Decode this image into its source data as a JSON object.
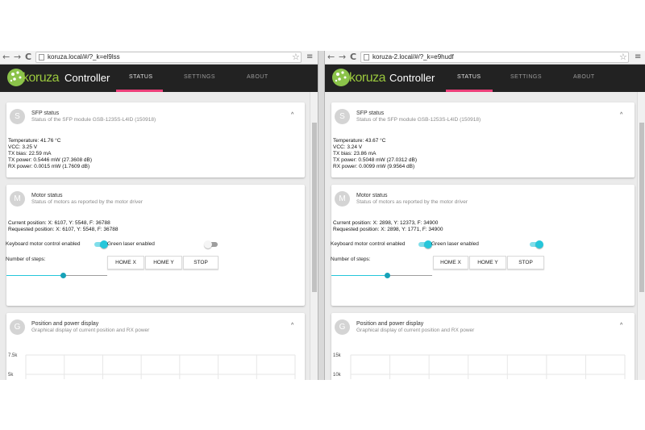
{
  "colors": {
    "accent": "#26c6da",
    "tab_underline": "#ec407a",
    "navbar": "#222222",
    "brand_green": "#9ac83d"
  },
  "windows": [
    {
      "nav": {
        "back": "←",
        "forward": "→",
        "reload": "C"
      },
      "url": "koruza.local/#/?_k=el9lss",
      "star_icon": "☆",
      "menu_icon": "≡",
      "brand": "koruza",
      "title": "Controller",
      "tabs": [
        "STATUS",
        "SETTINGS",
        "ABOUT"
      ],
      "sfp": {
        "avatar": "S",
        "title": "SFP status",
        "subtitle": "Status of the SFP module GSB-1235S-L4ID (150918)",
        "chevron": "^",
        "lines": [
          "Temperature: 41.76 °C",
          "VCC: 3.25 V",
          "TX bias: 22.59 mA",
          "TX power: 0.5446 mW (27.3608 dB)",
          "RX power: 0.0015 mW (1.7609 dB)"
        ]
      },
      "motor": {
        "avatar": "M",
        "title": "Motor status",
        "subtitle": "Status of motors as reported by the motor driver",
        "current": "Current position: X: 6107, Y: 5548, F: 36788",
        "requested": "Requested position: X: 6107, Y: 5548, F: 36788",
        "keyboard_label": "Keyboard motor control enabled",
        "keyboard_on": true,
        "laser_label": "Green laser enabled",
        "laser_on": false,
        "steps_label": "Number of steps:",
        "steps_fraction": 0.56,
        "buttons": [
          "HOME X",
          "HOME Y",
          "STOP"
        ]
      },
      "position": {
        "avatar": "G",
        "title": "Position and power display",
        "subtitle": "Graphical display of current position and RX power",
        "chevron": "^",
        "y_ticks": [
          "7.5k",
          "5k"
        ],
        "point_color": "#1f77b4"
      }
    },
    {
      "nav": {
        "back": "←",
        "forward": "→",
        "reload": "C"
      },
      "url": "koruza-2.local/#/?_k=e9hudf",
      "star_icon": "☆",
      "menu_icon": "≡",
      "brand": "koruza",
      "title": "Controller",
      "tabs": [
        "STATUS",
        "SETTINGS",
        "ABOUT"
      ],
      "sfp": {
        "avatar": "S",
        "title": "SFP status",
        "subtitle": "Status of the SFP module GSB-1253S-L4ID (150918)",
        "chevron": "^",
        "lines": [
          "Temperature: 43.67 °C",
          "VCC: 3.24 V",
          "TX bias: 23.86 mA",
          "TX power: 0.5048 mW (27.0312 dB)",
          "RX power: 0.0099 mW (9.9564 dB)"
        ]
      },
      "motor": {
        "avatar": "M",
        "title": "Motor status",
        "subtitle": "Status of motors as reported by the motor driver",
        "current": "Current position: X: 2898, Y: 12373, F: 34900",
        "requested": "Requested position: X: 2898, Y: 1771, F: 34900",
        "keyboard_label": "Keyboard motor control enabled",
        "keyboard_on": true,
        "laser_label": "Green laser enabled",
        "laser_on": true,
        "steps_label": "Number of steps:",
        "steps_fraction": 0.55,
        "buttons": [
          "HOME X",
          "HOME Y",
          "STOP"
        ]
      },
      "position": {
        "avatar": "G",
        "title": "Position and power display",
        "subtitle": "Graphical display of current position and RX power",
        "chevron": "^",
        "y_ticks": [
          "15k",
          "10k"
        ],
        "point_color": "#1abc9c"
      }
    }
  ]
}
